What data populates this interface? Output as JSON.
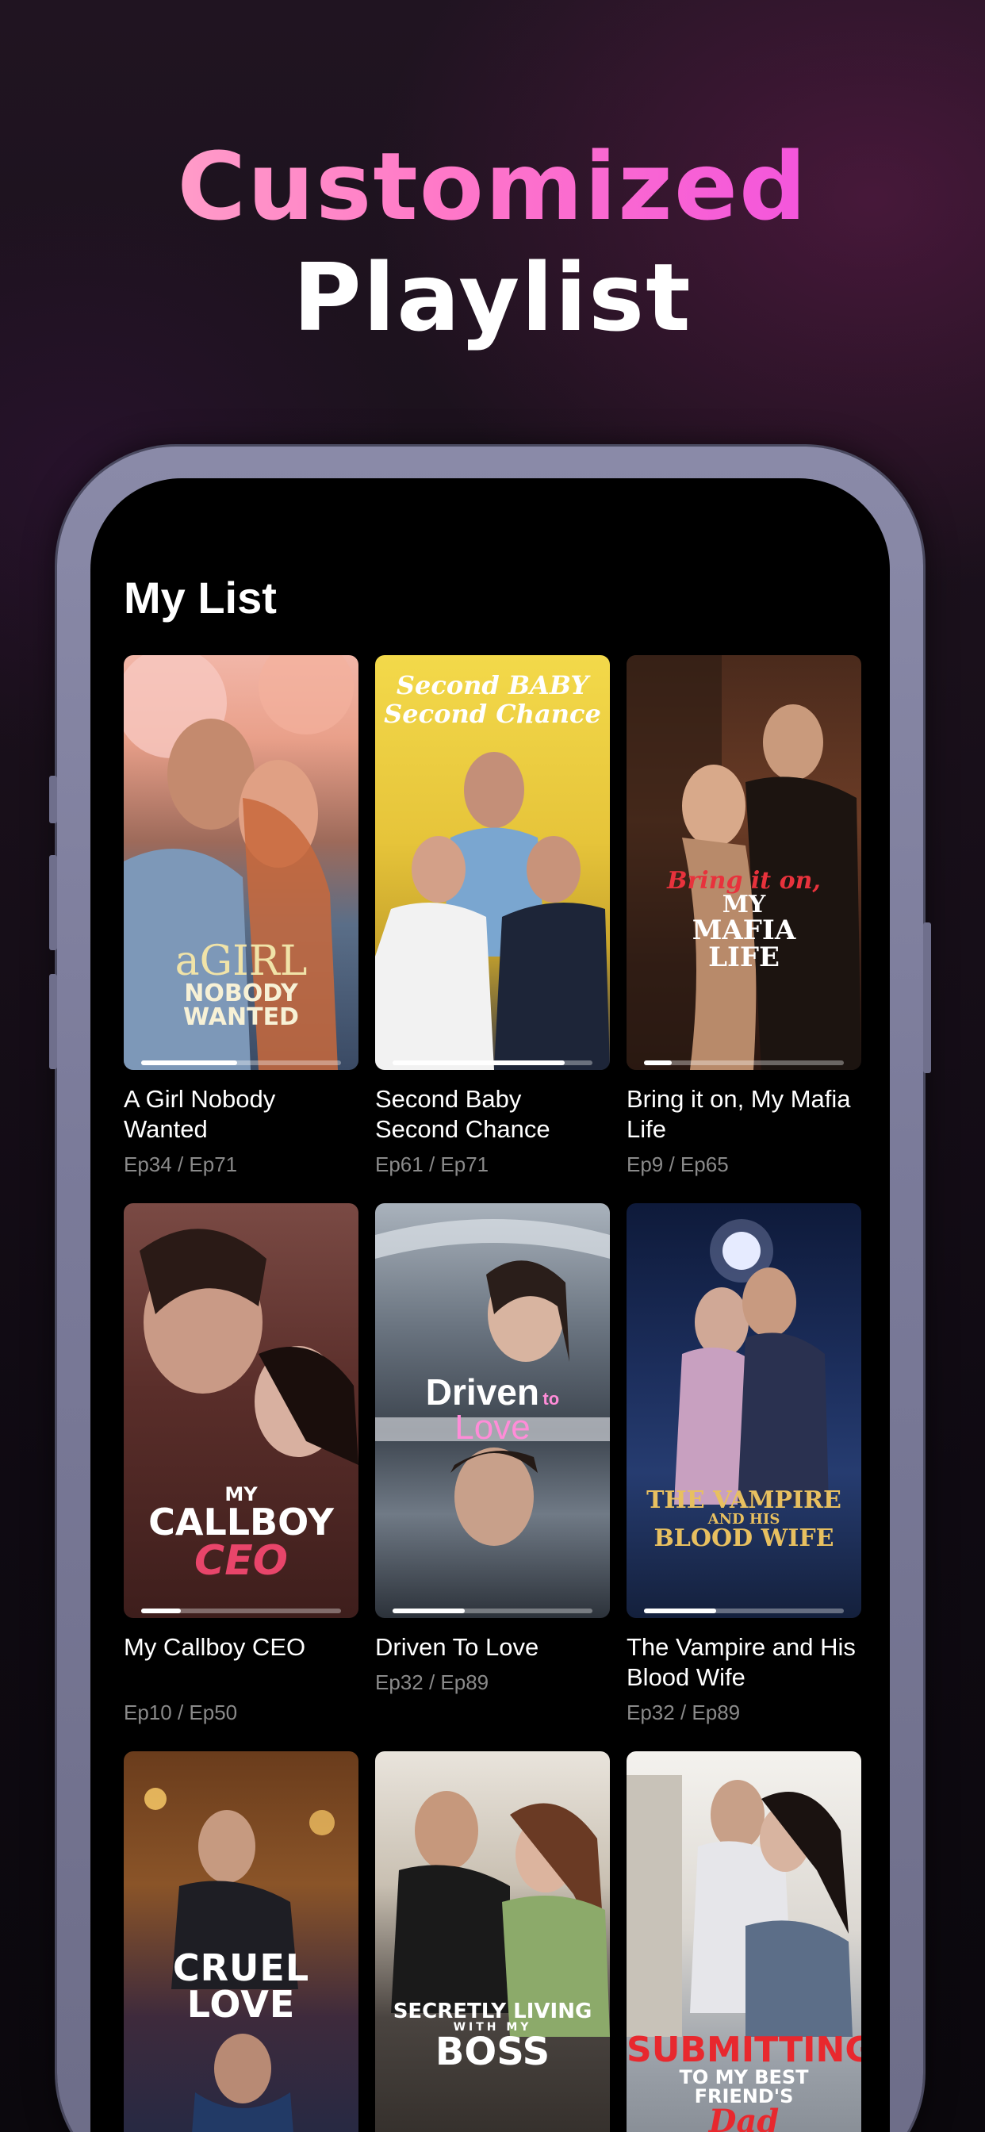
{
  "headline": {
    "line1": "Customized",
    "line2": "Playlist"
  },
  "page": {
    "title": "My List"
  },
  "cards": [
    {
      "title": "A Girl Nobody Wanted",
      "episode": "Ep34 / Ep71",
      "progress": 0.48,
      "poster_text": [
        "aGIRL",
        "NOBODY",
        "WANTED"
      ]
    },
    {
      "title": "Second Baby Second Chance",
      "episode": "Ep61 / Ep71",
      "progress": 0.86,
      "poster_text": [
        "Second BABY",
        "Second Chance"
      ]
    },
    {
      "title": "Bring it on, My Mafia Life",
      "episode": "Ep9 / Ep65",
      "progress": 0.14,
      "poster_text": [
        "Bring it on,",
        "MY",
        "MAFIA",
        "LIFE"
      ]
    },
    {
      "title": "My Callboy CEO",
      "episode": "Ep10 / Ep50",
      "progress": 0.2,
      "poster_text": [
        "MY",
        "CALLBOY",
        "CEO"
      ]
    },
    {
      "title": "Driven To Love",
      "episode": "Ep32 / Ep89",
      "progress": 0.36,
      "poster_text": [
        "Driven",
        "to",
        "Love"
      ]
    },
    {
      "title": "The Vampire and His Blood Wife",
      "episode": "Ep32 / Ep89",
      "progress": 0.36,
      "poster_text": [
        "THE VAMPIRE",
        "AND HIS",
        "BLOOD WIFE"
      ]
    },
    {
      "title": "",
      "episode": "",
      "progress": null,
      "poster_text": [
        "CRUEL LOVE"
      ]
    },
    {
      "title": "",
      "episode": "",
      "progress": null,
      "poster_text": [
        "SECRETLY LIVING",
        "WITH MY",
        "BOSS"
      ]
    },
    {
      "title": "",
      "episode": "",
      "progress": null,
      "poster_text": [
        "SUBMITTING",
        "TO MY BEST FRIEND'S",
        "Dad"
      ]
    }
  ],
  "colors": {
    "background": "#120b16",
    "accent_pink": "#ff78c8",
    "accent_magenta": "#ee44e6",
    "phone_frame": "#7b7b9a",
    "episode_text": "#8a8a8a"
  }
}
